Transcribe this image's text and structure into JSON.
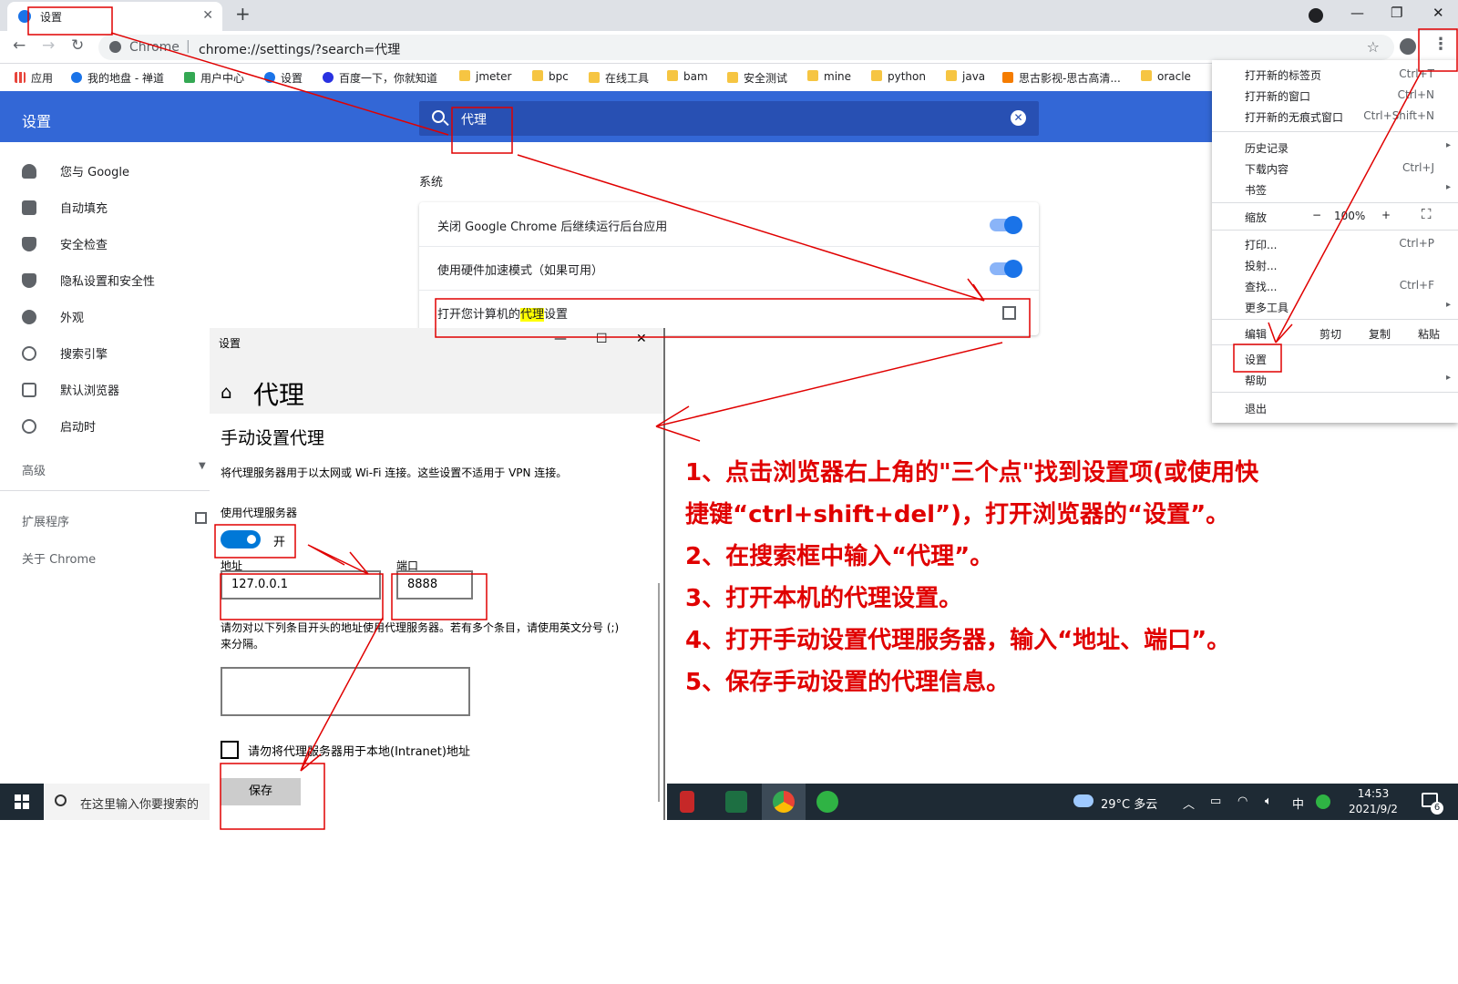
{
  "browser": {
    "tab_title": "设置",
    "tab_close": "✕",
    "new_tab": "+",
    "omnibox_host": "Chrome",
    "omnibox_url": "chrome://settings/?search=代理",
    "window_controls": [
      "—",
      "❐",
      "✕"
    ]
  },
  "bookmarks": [
    {
      "label": "应用",
      "icon": "apps-icon"
    },
    {
      "label": "我的地盘 - 禅道",
      "icon": "zentao-icon"
    },
    {
      "label": "用户中心",
      "icon": "leaf-icon"
    },
    {
      "label": "设置",
      "icon": "gear-icon"
    },
    {
      "label": "百度一下，你就知道",
      "icon": "baidu-icon"
    },
    {
      "label": "jmeter",
      "icon": "folder-icon"
    },
    {
      "label": "bpc",
      "icon": "folder-icon"
    },
    {
      "label": "在线工具",
      "icon": "folder-icon"
    },
    {
      "label": "bam",
      "icon": "folder-icon"
    },
    {
      "label": "安全测试",
      "icon": "folder-icon"
    },
    {
      "label": "mine",
      "icon": "folder-icon"
    },
    {
      "label": "python",
      "icon": "folder-icon"
    },
    {
      "label": "java",
      "icon": "folder-icon"
    },
    {
      "label": "思古影视-思古高清...",
      "icon": "sigu-icon"
    },
    {
      "label": "oracle",
      "icon": "folder-icon"
    }
  ],
  "settings": {
    "title": "设置",
    "search_value": "代理",
    "sidebar": [
      {
        "label": "您与 Google",
        "icon": "person-icon"
      },
      {
        "label": "自动填充",
        "icon": "clipboard-icon"
      },
      {
        "label": "安全检查",
        "icon": "shield-check-icon"
      },
      {
        "label": "隐私设置和安全性",
        "icon": "shield-icon"
      },
      {
        "label": "外观",
        "icon": "palette-icon"
      },
      {
        "label": "搜索引擎",
        "icon": "search-icon"
      },
      {
        "label": "默认浏览器",
        "icon": "browser-icon"
      },
      {
        "label": "启动时",
        "icon": "power-icon"
      }
    ],
    "advanced": "高级",
    "extensions": "扩展程序",
    "about": "关于 Chrome",
    "section_title": "系统",
    "rows": [
      "关闭 Google Chrome 后继续运行后台应用",
      "使用硬件加速模式（如果可用）"
    ],
    "proxy_row_prefix": "打开您计算机的",
    "proxy_row_highlight": "代理",
    "proxy_row_suffix": "设置"
  },
  "menu": {
    "items_top": [
      {
        "label": "打开新的标签页",
        "shortcut": "Ctrl+T"
      },
      {
        "label": "打开新的窗口",
        "shortcut": "Ctrl+N"
      },
      {
        "label": "打开新的无痕式窗口",
        "shortcut": "Ctrl+Shift+N"
      }
    ],
    "items_mid": [
      {
        "label": "历史记录",
        "shortcut": "▸"
      },
      {
        "label": "下载内容",
        "shortcut": "Ctrl+J"
      },
      {
        "label": "书签",
        "shortcut": "▸"
      }
    ],
    "zoom_label": "缩放",
    "zoom_minus": "−",
    "zoom_value": "100%",
    "zoom_plus": "+",
    "items_tools": [
      {
        "label": "打印...",
        "shortcut": "Ctrl+P"
      },
      {
        "label": "投射...",
        "shortcut": ""
      },
      {
        "label": "查找...",
        "shortcut": "Ctrl+F"
      },
      {
        "label": "更多工具",
        "shortcut": "▸"
      }
    ],
    "edit_label": "编辑",
    "cut": "剪切",
    "copy": "复制",
    "paste": "粘贴",
    "settings": "设置",
    "help": "帮助",
    "exit": "退出"
  },
  "proxy_window": {
    "caption": "设置",
    "title": "代理",
    "heading": "手动设置代理",
    "description": "将代理服务器用于以太网或 Wi-Fi 连接。这些设置不适用于 VPN 连接。",
    "use_proxy_label": "使用代理服务器",
    "toggle_state": "开",
    "address_label": "地址",
    "address_value": "127.0.0.1",
    "port_label": "端口",
    "port_value": "8888",
    "exceptions_label": "请勿对以下列条目开头的地址使用代理服务器。若有多个条目，请使用英文分号 (;) 来分隔。",
    "local_check_label": "请勿将代理服务器用于本地(Intranet)地址",
    "save_label": "保存"
  },
  "taskbar": {
    "search_placeholder": "在这里输入你要搜索的",
    "weather": "29°C 多云",
    "ime": "中",
    "time": "14:53",
    "date": "2021/9/2",
    "notification_count": "6"
  },
  "instructions": [
    "1、点击浏览器右上角的\"三个点\"找到设置项(或使用快捷键“ctrl+shift+del”)，打开浏览器的“设置”。",
    "2、在搜索框中输入“代理”。",
    "3、打开本机的代理设置。",
    "4、打开手动设置代理服务器，输入“地址、端口”。",
    "5、保存手动设置的代理信息。"
  ],
  "colors": {
    "settings_blue": "#3367d6",
    "annotation_red": "#e00000",
    "highlight": "#ffff00",
    "win_accent": "#0078d7"
  }
}
